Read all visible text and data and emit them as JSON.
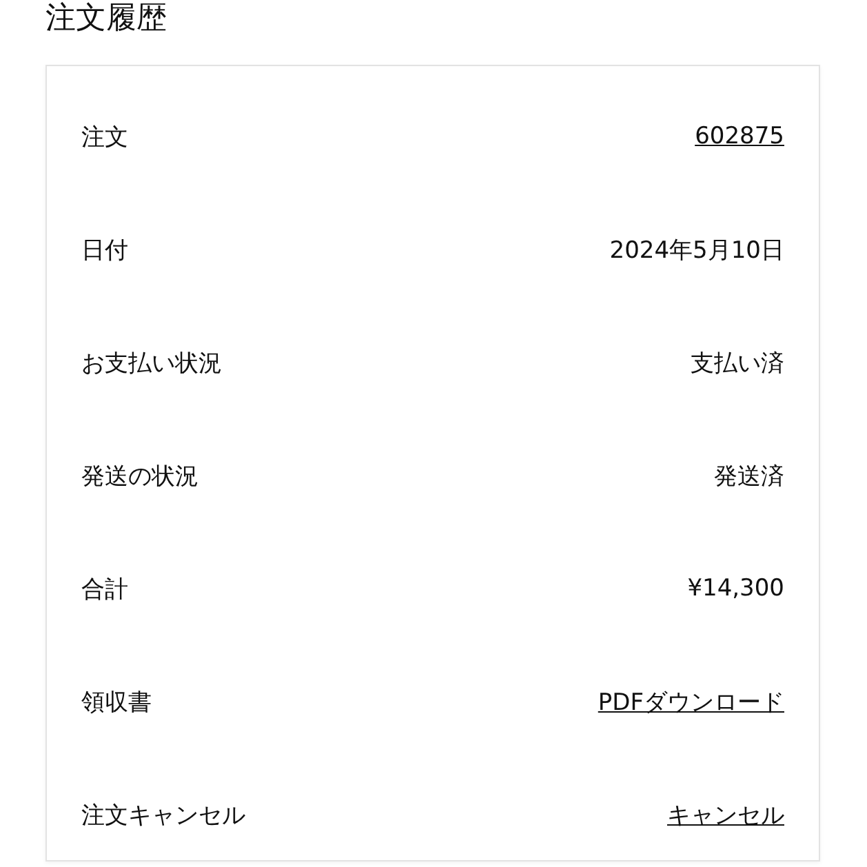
{
  "title": "注文履歴",
  "rows": [
    {
      "label": "注文",
      "value": "602875",
      "kind": "link"
    },
    {
      "label": "日付",
      "value": "2024年5月10日",
      "kind": "text"
    },
    {
      "label": "お支払い状況",
      "value": "支払い済",
      "kind": "text"
    },
    {
      "label": "発送の状況",
      "value": "発送済",
      "kind": "text"
    },
    {
      "label": "合計",
      "value": "¥14,300",
      "kind": "text"
    },
    {
      "label": "領収書",
      "value": "PDFダウンロード",
      "kind": "link"
    },
    {
      "label": "注文キャンセル",
      "value": "キャンセル",
      "kind": "link"
    }
  ]
}
